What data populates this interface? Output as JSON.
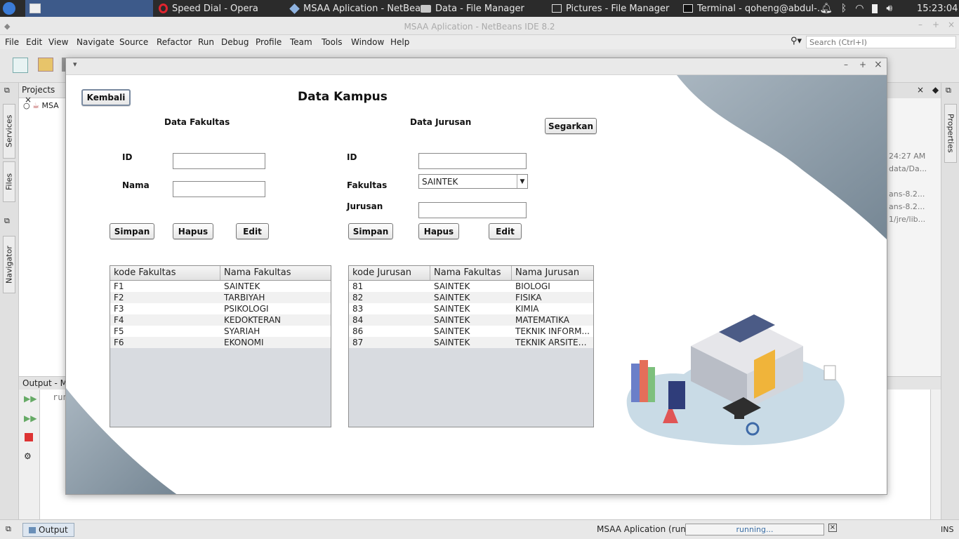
{
  "taskbar": {
    "tasks": [
      {
        "label": "Speed Dial - Opera",
        "icon": "opera-icon"
      },
      {
        "label": "MSAA Aplication - NetBea...",
        "icon": "netbeans-icon"
      },
      {
        "label": "Data - File Manager",
        "icon": "folder-icon"
      },
      {
        "label": "Pictures - File Manager",
        "icon": "image-viewer-icon"
      },
      {
        "label": "Terminal - qoheng@abdul-...",
        "icon": "terminal-icon"
      }
    ],
    "clock": "15:23:04"
  },
  "ide": {
    "title": "MSAA Aplication - NetBeans IDE 8.2",
    "menu": [
      "File",
      "Edit",
      "View",
      "Navigate",
      "Source",
      "Refactor",
      "Run",
      "Debug",
      "Profile",
      "Team",
      "Tools",
      "Window",
      "Help"
    ],
    "search_placeholder": "Search (Ctrl+I)",
    "projects_tab": "Projects",
    "project_root": "MSA",
    "left_tabs": [
      "Services",
      "Files",
      "Navigator"
    ],
    "right_tab": "Properties",
    "right_snippets": [
      "24:27 AM",
      "data/Da...",
      "ans-8.2...",
      "ans-8.2...",
      "1/jre/lib..."
    ],
    "output_title": "Output - M",
    "output_text": "run",
    "output_tab": "Output",
    "status_task": "MSAA Aplication (run)",
    "status_progress": "running...",
    "status_mode": "INS"
  },
  "dialog": {
    "title": "Data Kampus",
    "back_button": "Kembali",
    "refresh_button": "Segarkan",
    "fakultas": {
      "section_title": "Data Fakultas",
      "id_label": "ID",
      "nama_label": "Nama",
      "id_value": "",
      "nama_value": "",
      "save": "Simpan",
      "delete": "Hapus",
      "edit": "Edit",
      "columns": [
        "kode Fakultas",
        "Nama Fakultas"
      ],
      "rows": [
        [
          "F1",
          "SAINTEK"
        ],
        [
          "F2",
          "TARBIYAH"
        ],
        [
          "F3",
          "PSIKOLOGI"
        ],
        [
          "F4",
          "KEDOKTERAN"
        ],
        [
          "F5",
          "SYARIAH"
        ],
        [
          "F6",
          "EKONOMI"
        ]
      ]
    },
    "jurusan": {
      "section_title": "Data Jurusan",
      "id_label": "ID",
      "fakultas_label": "Fakultas",
      "jurusan_label": "Jurusan",
      "id_value": "",
      "fakultas_selected": "SAINTEK",
      "jurusan_value": "",
      "save": "Simpan",
      "delete": "Hapus",
      "edit": "Edit",
      "columns": [
        "kode Jurusan",
        "Nama Fakultas",
        "Nama Jurusan"
      ],
      "rows": [
        [
          "81",
          "SAINTEK",
          "BIOLOGI"
        ],
        [
          "82",
          "SAINTEK",
          "FISIKA"
        ],
        [
          "83",
          "SAINTEK",
          "KIMIA"
        ],
        [
          "84",
          "SAINTEK",
          "MATEMATIKA"
        ],
        [
          "86",
          "SAINTEK",
          "TEKNIK INFORM..."
        ],
        [
          "87",
          "SAINTEK",
          "TEKNIK ARSITEK..."
        ]
      ]
    }
  }
}
